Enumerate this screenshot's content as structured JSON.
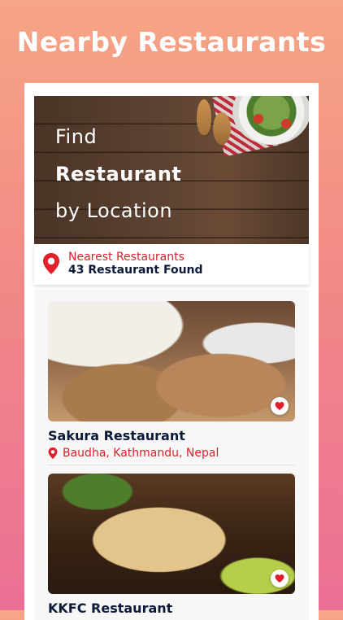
{
  "headline": "Nearby Restaurants",
  "hero": {
    "line1": "Find",
    "line2": "Restaurant",
    "line3": "by Location"
  },
  "nearby": {
    "label": "Nearest Restaurants",
    "count": "43 Restaurant Found"
  },
  "restaurants": [
    {
      "name": "Sakura Restaurant",
      "location": "Baudha, Kathmandu, Nepal"
    },
    {
      "name": "KKFC Restaurant",
      "location": ""
    }
  ],
  "icons": {
    "pin": "location-pin-icon",
    "favorite": "heart-icon"
  },
  "colors": {
    "accent": "#e0202b",
    "text_dark": "#0c1a3a"
  }
}
